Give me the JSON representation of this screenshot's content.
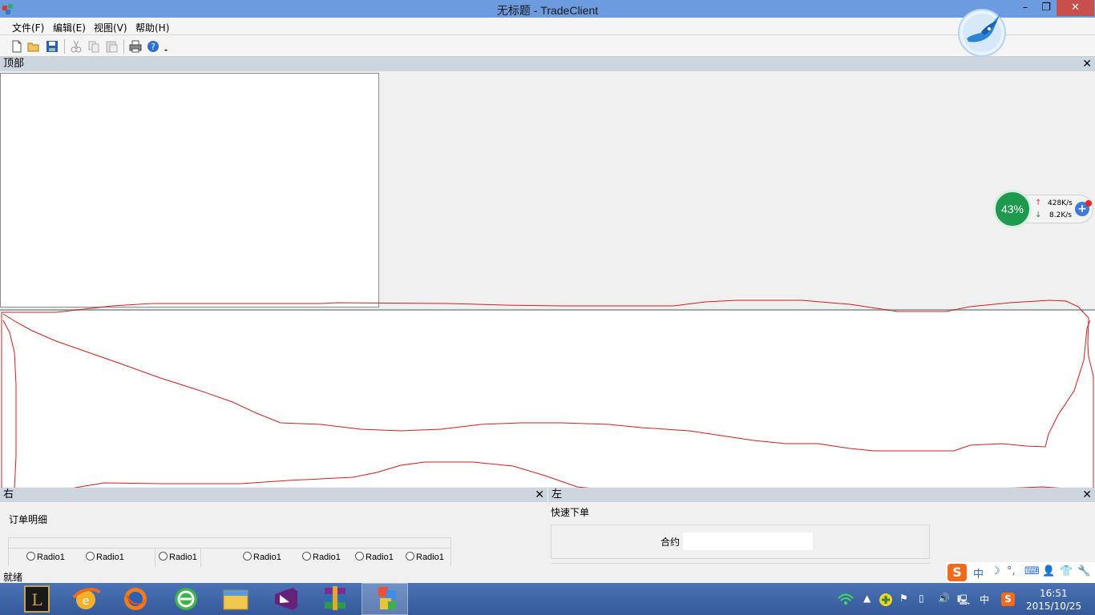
{
  "window": {
    "title": "无标题 - TradeClient",
    "minimize_glyph": "–",
    "restore_glyph": "❐",
    "close_glyph": "✕"
  },
  "menubar": {
    "items": [
      {
        "label": "文件(F)"
      },
      {
        "label": "编辑(E)"
      },
      {
        "label": "视图(V)"
      },
      {
        "label": "帮助(H)"
      }
    ]
  },
  "toolbar": {
    "icons": [
      "new-icon",
      "open-icon",
      "save-icon",
      "cut-icon",
      "copy-icon",
      "paste-icon",
      "print-icon",
      "help-icon"
    ]
  },
  "top_pane": {
    "title": "顶部",
    "close_glyph": "✕"
  },
  "net_widget": {
    "percent": "43%",
    "upload": "428K/s",
    "download": "8.2K/s",
    "plus": "+"
  },
  "right_pane": {
    "title": "右",
    "close_glyph": "✕",
    "group_label": "订单明细",
    "radios": [
      "Radio1",
      "Radio1",
      "Radio1",
      "Radio1",
      "Radio1",
      "Radio1",
      "Radio1"
    ]
  },
  "left_pane": {
    "title": "左",
    "close_glyph": "✕",
    "group_label": "快速下单",
    "contract_label": "合约",
    "contract_value": ""
  },
  "statusbar": {
    "text": "就绪"
  },
  "ime": {
    "logo": "S",
    "mode": "中",
    "moon": "☽",
    "punct": "°,",
    "keyboard": "⌨",
    "user": "👤",
    "shirt": "👕",
    "wrench": "🔧"
  },
  "taskbar": {
    "apps": [
      "league-of-legends-icon",
      "ie-browser-icon",
      "firefox-icon",
      "360-browser-icon",
      "file-explorer-icon",
      "visual-studio-icon",
      "winrar-icon",
      "mfc-app-icon"
    ],
    "tray_ime": "中",
    "time": "16:51",
    "date": "2015/10/25"
  }
}
